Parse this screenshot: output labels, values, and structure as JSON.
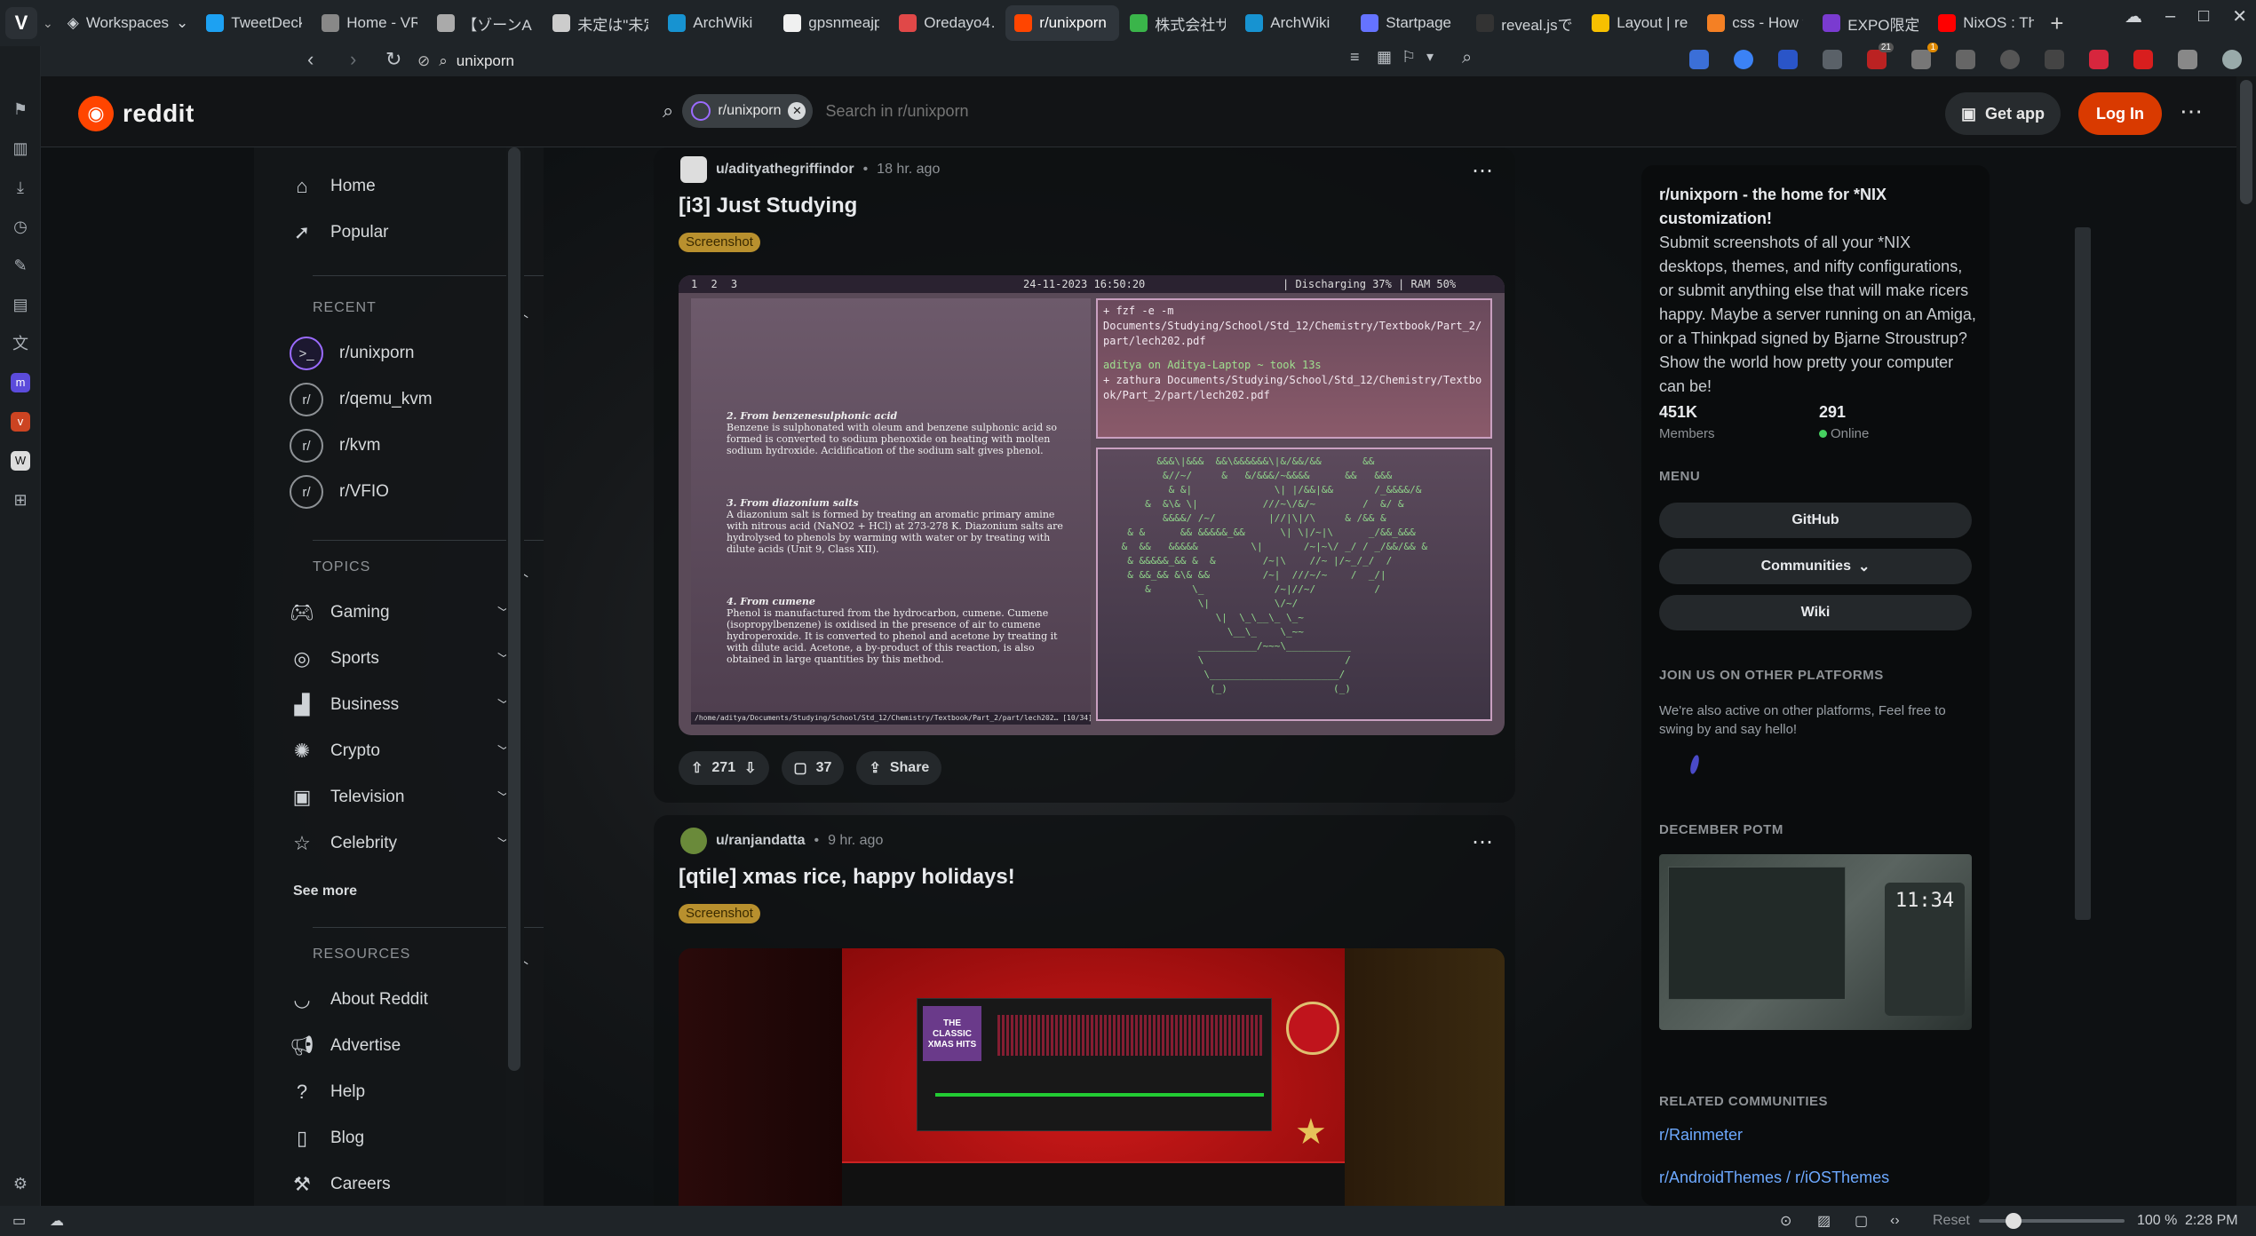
{
  "browser": {
    "workspaces_label": "Workspaces",
    "tabs": [
      {
        "title": "TweetDeck",
        "color": "#1da1f2"
      },
      {
        "title": "Home - VR…",
        "color": "#888888"
      },
      {
        "title": "【ゾーンA…",
        "color": "#aaaaaa"
      },
      {
        "title": "未定は\"未定\"",
        "color": "#cccccc"
      },
      {
        "title": "ArchWiki",
        "color": "#1793d1"
      },
      {
        "title": "gpsnmeajp…",
        "color": "#f0f0f0"
      },
      {
        "title": "Oredayo4…",
        "color": "#e04848"
      },
      {
        "title": "r/unixporn - th",
        "color": "#ff4500"
      },
      {
        "title": "株式会社サ…",
        "color": "#3ab54a"
      },
      {
        "title": "ArchWiki",
        "color": "#1793d1"
      },
      {
        "title": "Startpage …",
        "color": "#6573ff"
      },
      {
        "title": "reveal.jsで…",
        "color": "#333333"
      },
      {
        "title": "Layout | re…",
        "color": "#f7c000"
      },
      {
        "title": "css - How t…",
        "color": "#f48024"
      },
      {
        "title": "EXPO限定…",
        "color": "#7a3bd0"
      },
      {
        "title": "NixOS : Th…",
        "color": "#ff0000"
      }
    ],
    "address": "unixporn",
    "ext_badge_1": "21",
    "ext_badge_2": "1"
  },
  "header": {
    "logo_text": "reddit",
    "search_chip": "r/unixporn",
    "search_placeholder": "Search in r/unixporn",
    "get_app": "Get app",
    "log_in": "Log In"
  },
  "leftnav": {
    "home": "Home",
    "popular": "Popular",
    "recent_title": "RECENT",
    "recent": [
      "r/unixporn",
      "r/qemu_kvm",
      "r/kvm",
      "r/VFIO"
    ],
    "topics_title": "TOPICS",
    "topics": [
      "Gaming",
      "Sports",
      "Business",
      "Crypto",
      "Television",
      "Celebrity"
    ],
    "see_more": "See more",
    "resources_title": "RESOURCES",
    "resources": [
      "About Reddit",
      "Advertise",
      "Help",
      "Blog",
      "Careers"
    ]
  },
  "posts": [
    {
      "user": "u/adityathegriffindor",
      "time": "18 hr. ago",
      "title": "[i3] Just Studying",
      "flair": "Screenshot",
      "votes": "271",
      "comments": "37",
      "share": "Share",
      "screenshot": {
        "workspaces": "1  2  3",
        "datetime": "24-11-2023 16:50:20",
        "bar_right": "| Discharging 37% | RAM 50%",
        "term_lines": [
          "+ fzf -e -m",
          "Documents/Studying/School/Std_12/Chemistry/Textbook/Part_2/",
          "part/lech202.pdf",
          "aditya on Aditya-Laptop ~ took 13s",
          "+ zathura Documents/Studying/School/Std_12/Chemistry/Textbo",
          "ok/Part_2/part/lech202.pdf"
        ],
        "doc_lines": [
          "2. From benzenesulphonic acid",
          "Benzene is sulphonated with oleum and benzene sulphonic acid so",
          "formed is converted to sodium phenoxide on heating with molten",
          "sodium hydroxide. Acidification of the sodium salt gives phenol.",
          "3. From diazonium salts",
          "A diazonium salt is formed by treating an aromatic primary amine",
          "with nitrous acid (NaNO2 + HCl) at 273-278 K. Diazonium salts are",
          "hydrolysed to phenols by warming with water or by treating with",
          "dilute acids (Unit 9, Class XII).",
          "4. From cumene",
          "Phenol is manufactured from the hydrocarbon, cumene. Cumene",
          "(isopropylbenzene) is oxidised in the presence of air to cumene",
          "hydroperoxide. It is converted to phenol and acetone by treating it",
          "with dilute acid. Acetone, a by-product of this reaction, is also",
          "obtained in large quantities by this method."
        ],
        "doc_path": "/home/aditya/Documents/Studying/School/Std_12/Chemistry/Textbook/Part_2/part/lech202… [10/34]"
      }
    },
    {
      "user": "u/ranjandatta",
      "time": "9 hr. ago",
      "title": "[qtile] xmas rice, happy holidays!",
      "flair": "Screenshot",
      "album": "THE CLASSIC XMAS HITS"
    }
  ],
  "sidebar": {
    "title": "r/unixporn - the home for *NIX customization!",
    "description": "Submit screenshots of all your *NIX desktops, themes, and nifty configurations, or submit anything else that will make ricers happy. Maybe a server running on an Amiga, or a Thinkpad signed by Bjarne Stroustrup? Show the world how pretty your computer can be!",
    "members_count": "451K",
    "members_label": "Members",
    "online_count": "291",
    "online_label": "Online",
    "menu_title": "MENU",
    "menu": [
      "GitHub",
      "Communities",
      "Wiki"
    ],
    "platforms_title": "JOIN US ON OTHER PLATFORMS",
    "platforms_text": "We're also active on other platforms, Feel free to swing by and say hello!",
    "potm_title": "DECEMBER POTM",
    "potm_clock": "11:34",
    "related_title": "RELATED COMMUNITIES",
    "related": [
      "r/Rainmeter",
      "r/AndroidThemes / r/iOSThemes"
    ]
  },
  "statusbar": {
    "reset": "Reset",
    "zoom": "100 %",
    "time": "2:28 PM"
  },
  "colors": {
    "accent": "#ff4500",
    "login": "#d93a00",
    "link": "#6da9ff",
    "flair": "#b8902e"
  }
}
